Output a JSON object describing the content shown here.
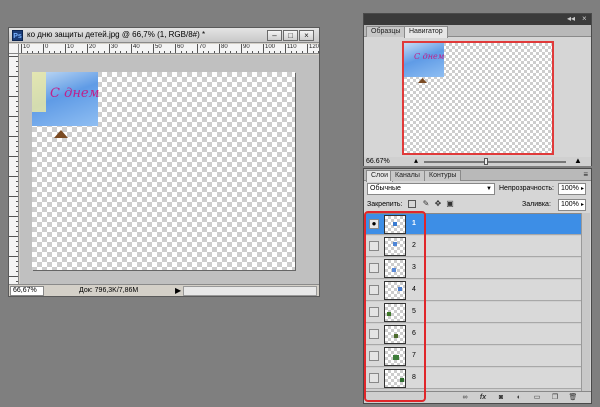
{
  "document": {
    "app_icon": "Ps",
    "title": "ко дню защиты детей.jpg @ 66,7% (1, RGB/8#) *",
    "ruler_top_labels": [
      "10",
      "0",
      "10",
      "20",
      "30",
      "40",
      "50",
      "60",
      "70",
      "80",
      "90",
      "100",
      "110",
      "120"
    ],
    "canvas_text": "С днем",
    "status_zoom": "66,67%",
    "status_doc": "Док: 796,3K/7,86M",
    "status_arrow": "▶",
    "window_buttons": {
      "minimize": "–",
      "maximize": "□",
      "close": "×"
    }
  },
  "navigator": {
    "tabs": [
      "Образцы",
      "Навигатор"
    ],
    "active_tab": "Навигатор",
    "zoom_value": "66.67%",
    "header_controls": [
      "◂◂",
      "×"
    ]
  },
  "layers": {
    "tabs": [
      "Слои",
      "Каналы",
      "Контуры"
    ],
    "active_tab": "Слои",
    "blend_mode": "Обычные",
    "opacity_label": "Непрозрачность:",
    "opacity_value": "100%",
    "lock_label": "Закрепить:",
    "fill_label": "Заливка:",
    "fill_value": "100%",
    "items": [
      {
        "name": "1",
        "selected": true,
        "visible": true
      },
      {
        "name": "2",
        "selected": false,
        "visible": false
      },
      {
        "name": "3",
        "selected": false,
        "visible": false
      },
      {
        "name": "4",
        "selected": false,
        "visible": false
      },
      {
        "name": "5",
        "selected": false,
        "visible": false
      },
      {
        "name": "6",
        "selected": false,
        "visible": false
      },
      {
        "name": "7",
        "selected": false,
        "visible": false
      },
      {
        "name": "8",
        "selected": false,
        "visible": false
      }
    ],
    "bottom_icons": [
      "link-icon",
      "fx-icon",
      "mask-icon",
      "adjustment-icon",
      "group-icon",
      "new-layer-icon",
      "trash-icon"
    ]
  },
  "colors": {
    "selection": "#3d8ee6",
    "highlight": "#e0262a",
    "workspace": "#7f7f7f"
  }
}
